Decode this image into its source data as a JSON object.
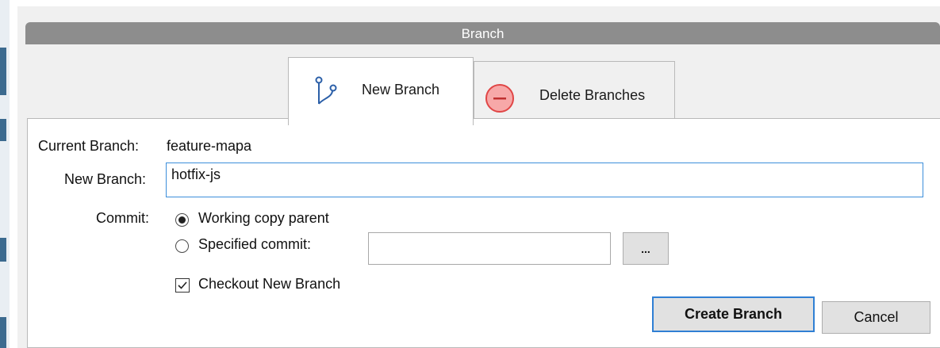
{
  "dialog": {
    "title": "Branch"
  },
  "tabs": [
    {
      "label": "New Branch",
      "icon": "branch-icon",
      "active": true
    },
    {
      "label": "Delete Branches",
      "icon": "minus-circle-icon",
      "active": false
    }
  ],
  "form": {
    "current_branch_label": "Current Branch:",
    "current_branch_value": "feature-mapa",
    "new_branch_label": "New Branch:",
    "new_branch_value": "hotfix-js",
    "commit_label": "Commit:",
    "commit_options": [
      {
        "label": "Working copy parent",
        "checked": true
      },
      {
        "label": "Specified commit:",
        "checked": false
      }
    ],
    "specified_commit_value": "",
    "browse_button_label": "...",
    "checkout_label": "Checkout New Branch",
    "checkout_checked": true
  },
  "buttons": {
    "create_label": "Create Branch",
    "cancel_label": "Cancel"
  },
  "colors": {
    "titlebar": "#8d8d8d",
    "focus_border": "#3b8edb",
    "delete_icon_fill": "#f7a8a8",
    "delete_icon_stroke": "#e04646"
  }
}
